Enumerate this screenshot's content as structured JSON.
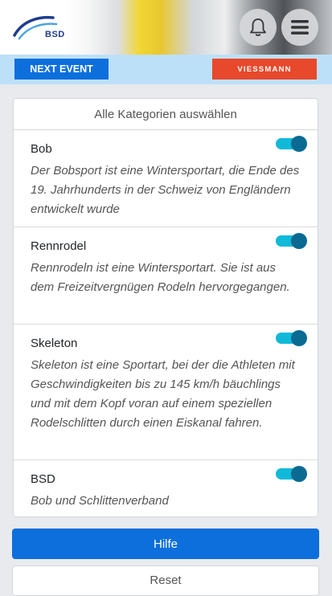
{
  "header": {
    "logo_text": "BSD",
    "icons": {
      "bell": "bell-icon",
      "menu": "hamburger-menu-icon"
    }
  },
  "sponsor": {
    "next_event_label": "NEXT EVENT",
    "viessmann_label": "VIESSMANN"
  },
  "filter": {
    "select_all_label": "Alle Kategorien auswählen",
    "categories": [
      {
        "title": "Bob",
        "description": "Der Bobsport ist eine Wintersportart, die Ende des 19. Jahrhunderts in der Schweiz von Engländern entwickelt wurde",
        "enabled": true
      },
      {
        "title": "Rennrodel",
        "description": "Rennrodeln ist eine Wintersportart. Sie ist aus dem Freizeitvergnügen Rodeln hervorgegangen.",
        "enabled": true
      },
      {
        "title": "Skeleton",
        "description": "Skeleton ist eine Sportart, bei der die Athleten mit Geschwindigkeiten bis zu 145 km/h bäuchlings und mit dem Kopf voran auf einem speziellen Rodelschlitten durch einen Eiskanal fahren.",
        "enabled": true
      },
      {
        "title": "BSD",
        "description": "Bob und Schlittenverband",
        "enabled": true
      }
    ]
  },
  "actions": {
    "help_label": "Hilfe",
    "reset_label": "Reset"
  },
  "colors": {
    "primary": "#0d6fdc",
    "sponsor_bar": "#bde0f9",
    "viessmann": "#e8482b",
    "toggle_track": "#10b9d8",
    "toggle_knob": "#0a6a92"
  }
}
